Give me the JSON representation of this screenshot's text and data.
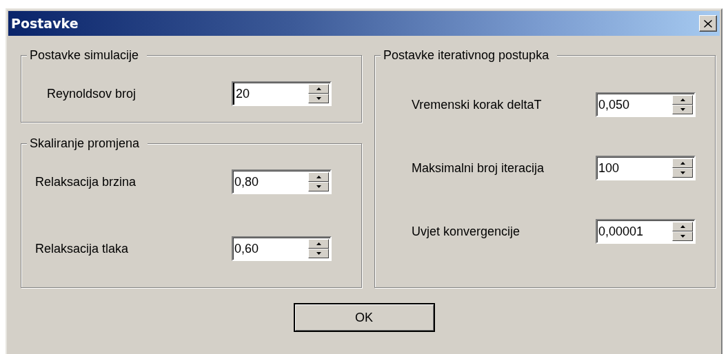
{
  "window": {
    "title": "Postavke"
  },
  "left_groups": [
    {
      "title": "Postavke simulacije",
      "rows": [
        {
          "label": "Reynoldsov broj",
          "value": "20",
          "focused": true
        }
      ]
    },
    {
      "title": "Skaliranje promjena",
      "rows": [
        {
          "label": "Relaksacija brzina",
          "value": "0,80",
          "focused": false
        },
        {
          "label": "Relaksacija tlaka",
          "value": "0,60",
          "focused": false
        }
      ]
    }
  ],
  "right_groups": [
    {
      "title": "Postavke iterativnog postupka",
      "rows": [
        {
          "label": "Vremenski korak deltaT",
          "value": "0,050",
          "focused": false
        },
        {
          "label": "Maksimalni broj iteracija",
          "value": "100",
          "focused": false
        },
        {
          "label": "Uvjet konvergencije",
          "value": "0,00001",
          "focused": false
        }
      ]
    }
  ],
  "buttons": [
    {
      "label": "OK",
      "default": true
    }
  ]
}
